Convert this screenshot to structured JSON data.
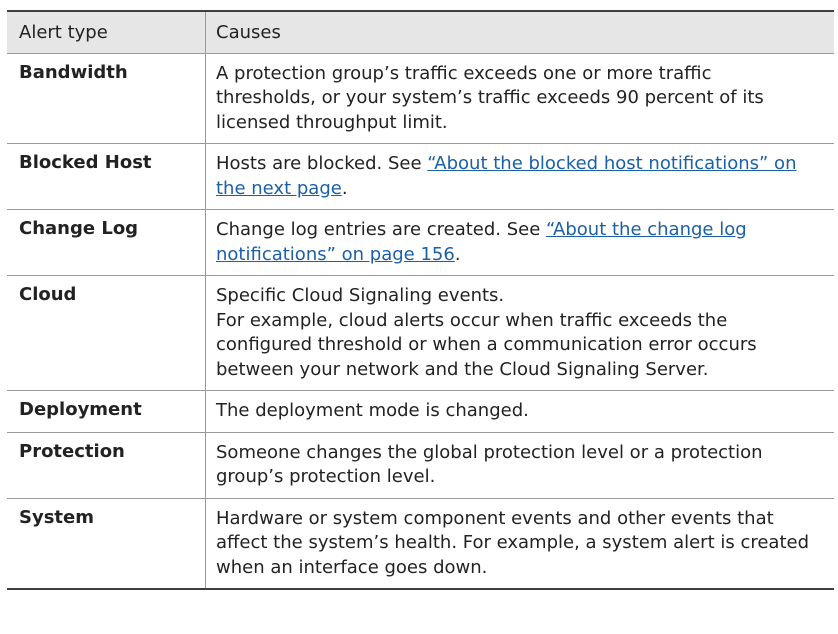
{
  "header": {
    "col1": "Alert type",
    "col2": "Causes"
  },
  "rows": [
    {
      "type": "Bandwidth",
      "lines": [
        "A protection group’s traffic exceeds one or more traffic",
        "thresholds, or your system’s traffic exceeds 90 percent of its",
        "licensed throughput limit."
      ]
    },
    {
      "type": "Blocked Host",
      "pre": "Hosts are blocked. See ",
      "link1": "“About the blocked host notifications” on",
      "link2": "the next page",
      "post": "."
    },
    {
      "type": "Change Log",
      "pre": "Change log entries are created. See ",
      "link1": "“About the change log",
      "link2": "notifications” on page 156",
      "post": "."
    },
    {
      "type": "Cloud",
      "lines": [
        "Specific Cloud Signaling events.",
        "For example, cloud alerts occur when traffic exceeds the",
        "configured threshold or when a communication error occurs",
        "between your network and the Cloud Signaling Server."
      ]
    },
    {
      "type": "Deployment",
      "lines": [
        "The deployment mode is changed."
      ]
    },
    {
      "type": "Protection",
      "lines": [
        "Someone changes the global protection level or a protection",
        "group’s protection level."
      ]
    },
    {
      "type": "System",
      "lines": [
        "Hardware or system component events and other events that",
        "affect the system’s health. For example, a system alert is created",
        "when an interface goes down."
      ]
    }
  ]
}
